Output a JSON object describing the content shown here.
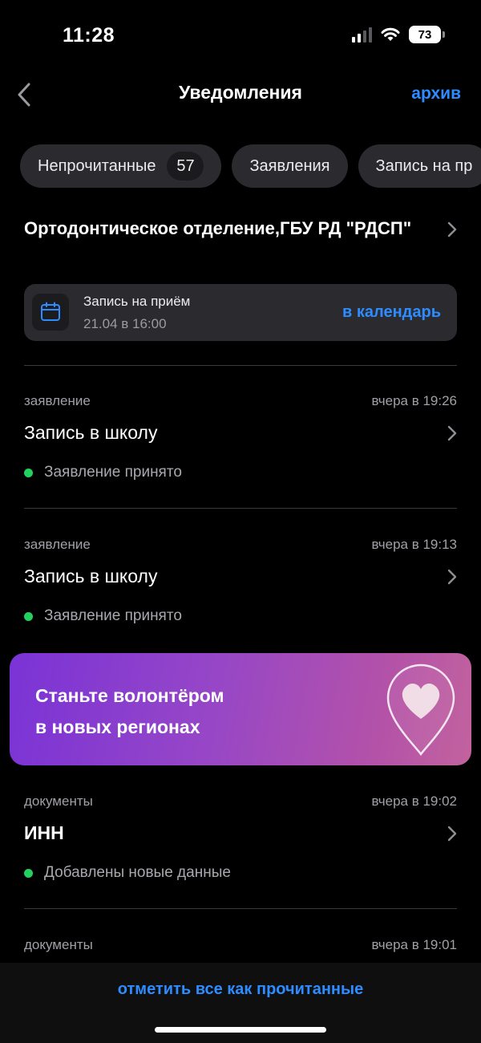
{
  "status": {
    "time": "11:28",
    "battery": "73"
  },
  "nav": {
    "title": "Уведомления",
    "archive": "архив"
  },
  "filters": [
    {
      "label": "Непрочитанные",
      "count": "57"
    },
    {
      "label": "Заявления"
    },
    {
      "label": "Запись на пр"
    }
  ],
  "org": {
    "title": "Ортодонтическое отделение,ГБУ РД \"РДСП\""
  },
  "appointment": {
    "title": "Запись на приём",
    "date": "21.04 в 16:00",
    "calendar_link": "в календарь"
  },
  "notifications": [
    {
      "category": "заявление",
      "time": "вчера в 19:26",
      "title": "Запись в школу",
      "status": "Заявление принято"
    },
    {
      "category": "заявление",
      "time": "вчера в 19:13",
      "title": "Запись в школу",
      "status": "Заявление принято"
    },
    {
      "category": "документы",
      "time": "вчера в 19:02",
      "title": "ИНН",
      "status": "Добавлены новые данные"
    },
    {
      "category": "документы",
      "time": "вчера в 19:01"
    }
  ],
  "banner": {
    "line1": "Станьте волонтёром",
    "line2": "в новых регионах"
  },
  "footer": {
    "mark_all": "отметить все как прочитанные"
  },
  "colors": {
    "accent": "#2d8cff",
    "status_ok": "#22d260",
    "card": "#2b2b2f"
  }
}
